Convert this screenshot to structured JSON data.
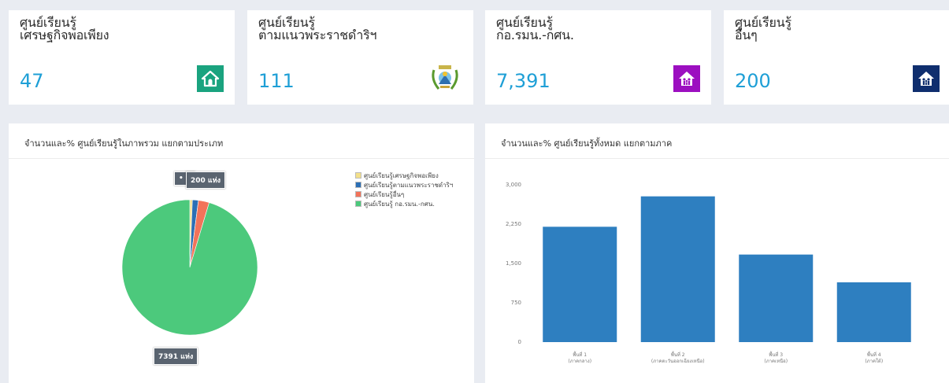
{
  "stats": [
    {
      "title_line1": "ศูนย์เรียนรู้",
      "title_line2": "เศรษฐกิจพอเพียง",
      "value": "47",
      "icon": "home-icon",
      "icon_bg": "#1aa37f"
    },
    {
      "title_line1": "ศูนย์เรียนรู้",
      "title_line2": "ตามแนวพระราชดำริฯ",
      "value": "111",
      "icon": "emblem-logo",
      "icon_bg": "#ffffff"
    },
    {
      "title_line1": "ศูนย์เรียนรู้",
      "title_line2": "กอ.รมน.-กศน.",
      "value": "7,391",
      "icon": "family-house-icon",
      "icon_bg": "#9c0fc0"
    },
    {
      "title_line1": "ศูนย์เรียนรู้",
      "title_line2": "อื่นๆ",
      "value": "200",
      "icon": "family-house-icon",
      "icon_bg": "#0f2e6e"
    }
  ],
  "pie_panel": {
    "title": "จำนวนและ% ศูนย์เรียนรู้ในภาพรวม แยกตามประเภท",
    "tooltip_small": "• 1",
    "tooltip_top": "200 แห่ง",
    "tooltip_bottom": "7391 แห่ง"
  },
  "bar_panel": {
    "title": "จำนวนและ% ศูนย์เรียนรู้ทั้งหมด แยกตามภาค"
  },
  "chart_data": [
    {
      "type": "pie",
      "title": "จำนวนและ% ศูนย์เรียนรู้ในภาพรวม แยกตามประเภท",
      "legend_position": "top-right",
      "series": [
        {
          "name": "ศูนย์เรียนรู้เศรษฐกิจพอเพียง",
          "value": 47,
          "color": "#f3e08a"
        },
        {
          "name": "ศูนย์เรียนรู้ตามแนวพระราชดำริฯ",
          "value": 111,
          "color": "#2c6fb5"
        },
        {
          "name": "ศูนย์เรียนรู้อื่นๆ",
          "value": 200,
          "color": "#f2735a"
        },
        {
          "name": "ศูนย์เรียนรู้ กอ.รมน.-กศน.",
          "value": 7391,
          "color": "#4cc97c"
        }
      ]
    },
    {
      "type": "bar",
      "title": "จำนวนและ% ศูนย์เรียนรู้ทั้งหมด แยกตามภาค",
      "categories": [
        [
          "พื้นที่ 1",
          "(ภาคกลาง)"
        ],
        [
          "พื้นที่ 2",
          "(ภาคตะวันออกเฉียงเหนือ)"
        ],
        [
          "พื้นที่ 3",
          "(ภาคเหนือ)"
        ],
        [
          "พื้นที่ 4",
          "(ภาคใต้)"
        ]
      ],
      "values": [
        2200,
        2780,
        1670,
        1140
      ],
      "ylim": [
        0,
        3000
      ],
      "yticks": [
        "0",
        "750",
        "1,500",
        "2,250",
        "3,000"
      ],
      "grid": false,
      "bar_color": "#2e7fc0"
    }
  ]
}
